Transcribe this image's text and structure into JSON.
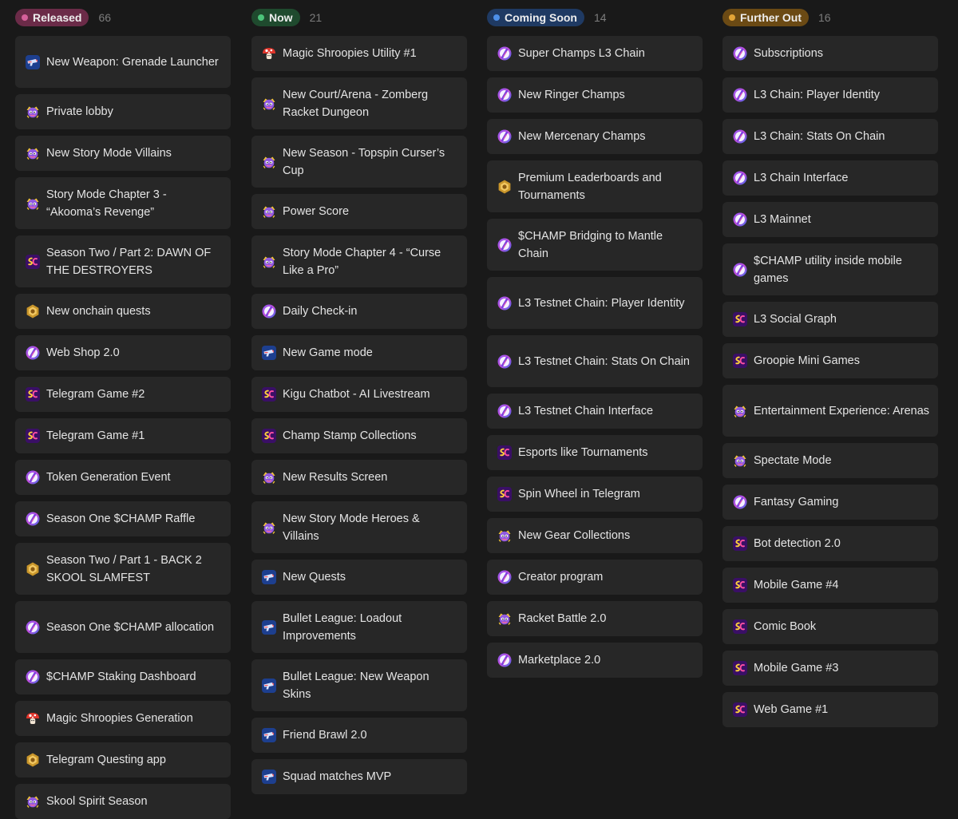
{
  "columns": [
    {
      "label": "Released",
      "count": "66",
      "pill_color": "#6b2b48",
      "dot_color": "#d6609a",
      "items": [
        {
          "text": "New Weapon: Grenade Launcher",
          "icon": "blaster-icon"
        },
        {
          "text": "Private lobby",
          "icon": "champ-avatar-icon"
        },
        {
          "text": "New Story Mode Villains",
          "icon": "champ-avatar-icon"
        },
        {
          "text": "Story Mode Chapter 3 - “Akooma’s Revenge”",
          "icon": "champ-avatar-icon"
        },
        {
          "text": "Season Two / Part 2: DAWN OF THE DESTROYERS",
          "icon": "sc-logo-icon"
        },
        {
          "text": "New onchain quests",
          "icon": "gold-badge-icon"
        },
        {
          "text": "Web Shop 2.0",
          "icon": "token-icon"
        },
        {
          "text": "Telegram Game #2",
          "icon": "sc-logo-icon"
        },
        {
          "text": "Telegram Game #1",
          "icon": "sc-logo-icon"
        },
        {
          "text": "Token Generation Event",
          "icon": "token-icon"
        },
        {
          "text": "Season One $CHAMP Raffle",
          "icon": "token-icon"
        },
        {
          "text": "Season Two / Part 1 - BACK 2 SKOOL SLAMFEST",
          "icon": "gold-badge-icon"
        },
        {
          "text": "Season One $CHAMP allocation",
          "icon": "token-icon"
        },
        {
          "text": "$CHAMP Staking Dashboard",
          "icon": "token-icon"
        },
        {
          "text": "Magic Shroopies Generation",
          "icon": "mushroom-icon"
        },
        {
          "text": "Telegram Questing app",
          "icon": "gold-badge-icon"
        },
        {
          "text": "Skool Spirit Season",
          "icon": "champ-avatar-icon"
        }
      ]
    },
    {
      "label": "Now",
      "count": "21",
      "pill_color": "#1f4a2e",
      "dot_color": "#4cc37a",
      "items": [
        {
          "text": "Magic Shroopies Utility #1",
          "icon": "mushroom-icon"
        },
        {
          "text": "New Court/Arena - Zomberg Racket Dungeon",
          "icon": "champ-avatar-icon"
        },
        {
          "text": "New Season - Topspin Curser’s Cup",
          "icon": "champ-avatar-icon"
        },
        {
          "text": "Power Score",
          "icon": "champ-avatar-icon"
        },
        {
          "text": "Story Mode Chapter 4 - “Curse Like a Pro”",
          "icon": "champ-avatar-icon"
        },
        {
          "text": "Daily Check-in",
          "icon": "token-icon"
        },
        {
          "text": "New Game mode",
          "icon": "blaster-icon"
        },
        {
          "text": "Kigu Chatbot - AI Livestream",
          "icon": "sc-logo-icon"
        },
        {
          "text": "Champ Stamp Collections",
          "icon": "sc-logo-icon"
        },
        {
          "text": "New Results Screen",
          "icon": "champ-avatar-icon"
        },
        {
          "text": "New Story Mode Heroes & Villains",
          "icon": "champ-avatar-icon"
        },
        {
          "text": "New Quests",
          "icon": "blaster-icon"
        },
        {
          "text": "Bullet League: Loadout Improvements",
          "icon": "blaster-icon"
        },
        {
          "text": "Bullet League: New Weapon Skins",
          "icon": "blaster-icon"
        },
        {
          "text": "Friend Brawl 2.0",
          "icon": "blaster-icon"
        },
        {
          "text": "Squad matches MVP",
          "icon": "blaster-icon"
        }
      ]
    },
    {
      "label": "Coming Soon",
      "count": "14",
      "pill_color": "#1f3a63",
      "dot_color": "#4d8fe8",
      "items": [
        {
          "text": "Super Champs L3 Chain",
          "icon": "token-icon"
        },
        {
          "text": "New Ringer Champs",
          "icon": "token-icon"
        },
        {
          "text": "New Mercenary Champs",
          "icon": "token-icon"
        },
        {
          "text": "Premium Leaderboards and Tournaments",
          "icon": "gold-badge-icon"
        },
        {
          "text": "$CHAMP Bridging to Mantle Chain",
          "icon": "token-icon"
        },
        {
          "text": "L3 Testnet Chain: Player Identity",
          "icon": "token-icon"
        },
        {
          "text": "L3 Testnet Chain: Stats On Chain",
          "icon": "token-icon"
        },
        {
          "text": "L3 Testnet Chain Interface",
          "icon": "token-icon"
        },
        {
          "text": "Esports like Tournaments",
          "icon": "sc-logo-icon"
        },
        {
          "text": "Spin Wheel in Telegram",
          "icon": "sc-logo-icon"
        },
        {
          "text": "New Gear Collections",
          "icon": "champ-avatar-icon"
        },
        {
          "text": "Creator program",
          "icon": "token-icon"
        },
        {
          "text": "Racket Battle 2.0",
          "icon": "champ-avatar-icon"
        },
        {
          "text": "Marketplace 2.0",
          "icon": "token-icon"
        }
      ]
    },
    {
      "label": "Further Out",
      "count": "16",
      "pill_color": "#6b4a14",
      "dot_color": "#e3a437",
      "items": [
        {
          "text": "Subscriptions",
          "icon": "token-icon"
        },
        {
          "text": "L3 Chain: Player Identity",
          "icon": "token-icon"
        },
        {
          "text": "L3 Chain: Stats On Chain",
          "icon": "token-icon"
        },
        {
          "text": "L3 Chain Interface",
          "icon": "token-icon"
        },
        {
          "text": "L3 Mainnet",
          "icon": "token-icon"
        },
        {
          "text": "$CHAMP utility inside mobile games",
          "icon": "token-icon"
        },
        {
          "text": "L3 Social Graph",
          "icon": "sc-logo-icon"
        },
        {
          "text": "Groopie Mini Games",
          "icon": "sc-logo-icon"
        },
        {
          "text": "Entertainment Experience: Arenas",
          "icon": "champ-avatar-icon"
        },
        {
          "text": "Spectate Mode",
          "icon": "champ-avatar-icon"
        },
        {
          "text": "Fantasy Gaming",
          "icon": "token-icon"
        },
        {
          "text": "Bot detection 2.0",
          "icon": "sc-logo-icon"
        },
        {
          "text": "Mobile Game #4",
          "icon": "sc-logo-icon"
        },
        {
          "text": "Comic Book",
          "icon": "sc-logo-icon"
        },
        {
          "text": "Mobile Game #3",
          "icon": "sc-logo-icon"
        },
        {
          "text": "Web Game #1",
          "icon": "sc-logo-icon"
        }
      ]
    }
  ]
}
